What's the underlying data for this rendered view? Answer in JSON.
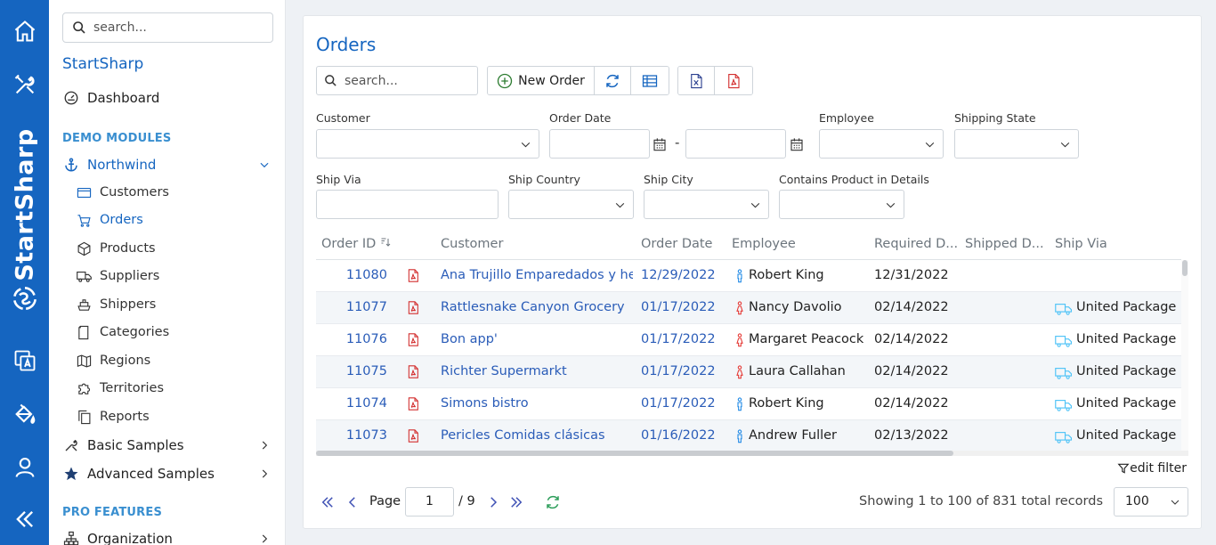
{
  "rail": {
    "brand": "StartSharp",
    "icons": [
      "home-icon",
      "tools-icon",
      "brand-logo-icon",
      "translate-icon",
      "paint-bucket-icon",
      "user-icon",
      "collapse-icon"
    ]
  },
  "sidebar": {
    "search_placeholder": "search...",
    "app_title": "StartSharp",
    "dashboard": "Dashboard",
    "demo_section": "DEMO MODULES",
    "northwind": "Northwind",
    "sub_items": [
      {
        "label": "Customers",
        "icon": "card-icon"
      },
      {
        "label": "Orders",
        "icon": "cart-icon"
      },
      {
        "label": "Products",
        "icon": "box-icon"
      },
      {
        "label": "Suppliers",
        "icon": "truck-icon"
      },
      {
        "label": "Shippers",
        "icon": "ship-icon"
      },
      {
        "label": "Categories",
        "icon": "folder-icon"
      },
      {
        "label": "Regions",
        "icon": "map-icon"
      },
      {
        "label": "Territories",
        "icon": "puzzle-icon"
      },
      {
        "label": "Reports",
        "icon": "copy-icon"
      }
    ],
    "basic_samples": "Basic Samples",
    "advanced_samples": "Advanced Samples",
    "pro_section": "PRO FEATURES",
    "organization": "Organization"
  },
  "page": {
    "title": "Orders",
    "search_placeholder": "search...",
    "new_order": "New Order"
  },
  "filters": {
    "customer": "Customer",
    "order_date": "Order Date",
    "date_separator": "-",
    "employee": "Employee",
    "shipping_state": "Shipping State",
    "ship_via": "Ship Via",
    "ship_country": "Ship Country",
    "ship_city": "Ship City",
    "contains_product": "Contains Product in Details"
  },
  "grid": {
    "columns": [
      "Order ID",
      "Customer",
      "Order Date",
      "Employee",
      "Required D...",
      "Shipped D...",
      "Ship Via"
    ],
    "rows": [
      {
        "id": "11080",
        "customer": "Ana Trujillo Emparedados y hel...",
        "date": "12/29/2022",
        "employee": "Robert King",
        "gender": "male",
        "required": "12/31/2022",
        "shipped": "",
        "ship_via": ""
      },
      {
        "id": "11077",
        "customer": "Rattlesnake Canyon Grocery",
        "date": "01/17/2022",
        "employee": "Nancy Davolio",
        "gender": "female",
        "required": "02/14/2022",
        "shipped": "",
        "ship_via": "United Package"
      },
      {
        "id": "11076",
        "customer": "Bon app'",
        "date": "01/17/2022",
        "employee": "Margaret Peacock",
        "gender": "female",
        "required": "02/14/2022",
        "shipped": "",
        "ship_via": "United Package"
      },
      {
        "id": "11075",
        "customer": "Richter Supermarkt",
        "date": "01/17/2022",
        "employee": "Laura Callahan",
        "gender": "female",
        "required": "02/14/2022",
        "shipped": "",
        "ship_via": "United Package"
      },
      {
        "id": "11074",
        "customer": "Simons bistro",
        "date": "01/17/2022",
        "employee": "Robert King",
        "gender": "male",
        "required": "02/14/2022",
        "shipped": "",
        "ship_via": "United Package"
      },
      {
        "id": "11073",
        "customer": "Pericles Comidas clásicas",
        "date": "01/16/2022",
        "employee": "Andrew Fuller",
        "gender": "male",
        "required": "02/13/2022",
        "shipped": "",
        "ship_via": "United Package"
      }
    ],
    "edit_filter": "edit filter"
  },
  "pager": {
    "page_label": "Page",
    "page_value": "1",
    "page_total": "/ 9",
    "status": "Showing 1 to 100 of 831 total records",
    "page_size": "100"
  },
  "colors": {
    "brand": "#1565c0",
    "link": "#2a5cb8",
    "pdf": "#d32f2f",
    "male": "#1e88e5",
    "female": "#e53935",
    "truck": "#4fc3f7"
  }
}
